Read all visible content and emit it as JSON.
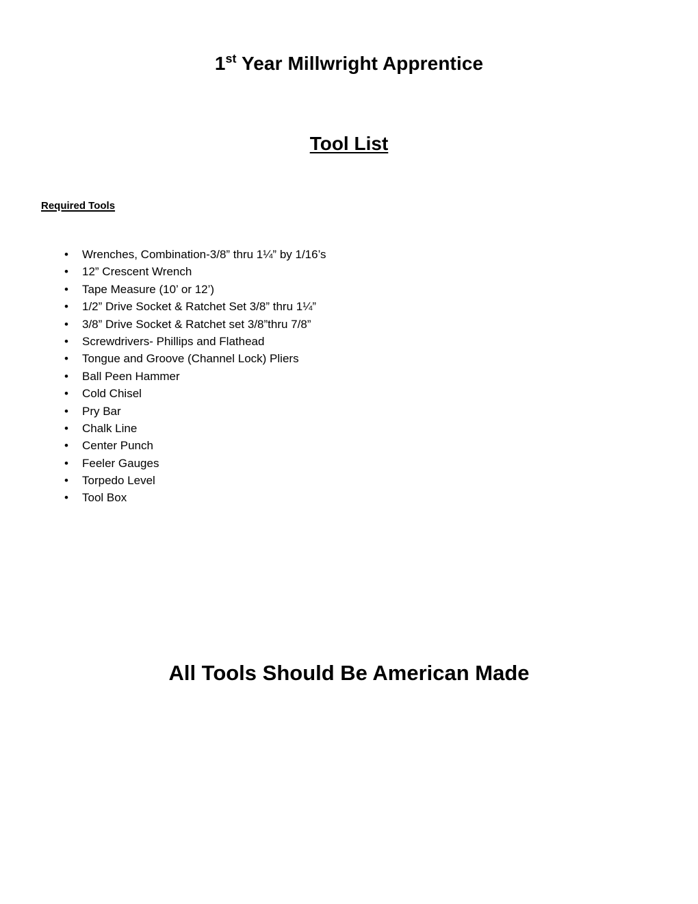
{
  "document": {
    "title_prefix": "1",
    "title_superscript": "st",
    "title_rest": " Year Millwright Apprentice",
    "section_heading": "Tool List",
    "sub_heading": "Required Tools",
    "closing_statement": "All Tools Should Be American Made",
    "bullet_glyph": "•",
    "text_color": "#000000",
    "background_color": "#ffffff"
  },
  "tools": [
    {
      "label": "Wrenches, Combination-3/8” thru 1¼” by 1/16’s"
    },
    {
      "label": "12” Crescent Wrench"
    },
    {
      "label": "Tape Measure (10’ or 12’)"
    },
    {
      "label": "1/2” Drive Socket & Ratchet Set 3/8” thru 1¼”"
    },
    {
      "label": "3/8” Drive Socket & Ratchet set 3/8”thru 7/8”"
    },
    {
      "label": "Screwdrivers- Phillips and Flathead"
    },
    {
      "label": "Tongue and Groove (Channel Lock) Pliers"
    },
    {
      "label": "Ball Peen Hammer"
    },
    {
      "label": "Cold Chisel"
    },
    {
      "label": "Pry Bar"
    },
    {
      "label": "Chalk Line"
    },
    {
      "label": "Center Punch"
    },
    {
      "label": "Feeler Gauges"
    },
    {
      "label": "Torpedo Level"
    },
    {
      "label": "Tool Box"
    }
  ]
}
